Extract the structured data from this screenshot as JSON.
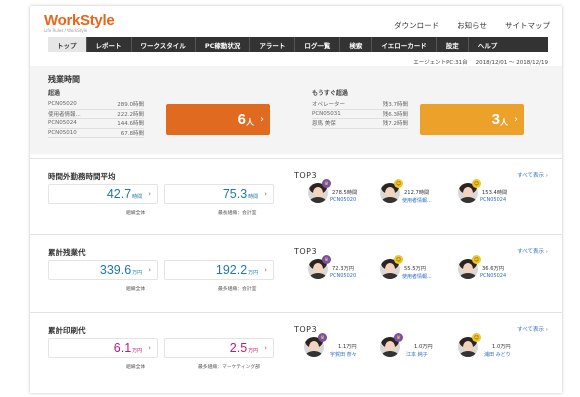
{
  "app": {
    "logo": "WorkStyle",
    "logo_sub": "Life Rules / WorkStyle"
  },
  "topnav": [
    "ダウンロード",
    "お知らせ",
    "サイトマップ"
  ],
  "menu": [
    "トップ",
    "レポート",
    "ワークスタイル",
    "PC稼動状況",
    "アラート",
    "ログ一覧",
    "検索",
    "イエローカード",
    "設定",
    "ヘルプ"
  ],
  "subinfo": {
    "agent": "エージェントPC:31台",
    "period": "2018/12/01 ～ 2018/12/19"
  },
  "overtime": {
    "title": "残業時間",
    "exceeded": {
      "label": "超過",
      "rows": [
        {
          "name": "PCN05020",
          "value": "289.0時間"
        },
        {
          "name": "使用者情報...",
          "value": "222.2時間"
        },
        {
          "name": "PCN05024",
          "value": "144.6時間"
        },
        {
          "name": "PCN05010",
          "value": "67.8時間"
        }
      ],
      "count": "6",
      "unit": "人"
    },
    "soon": {
      "label": "もうすぐ超過",
      "rows": [
        {
          "name": "オペレーター",
          "value": "残3.7時間"
        },
        {
          "name": "PCN05031",
          "value": "残6.3時間"
        },
        {
          "name": "恩馬 美保",
          "value": "残7.2時間"
        }
      ],
      "count": "3",
      "unit": "人"
    },
    "colors": {
      "exceeded": "#e06a1f",
      "soon": "#eba12a"
    }
  },
  "sections": [
    {
      "title": "時間外勤務時間平均",
      "card1": {
        "value": "42.7",
        "unit": "時間",
        "caption": "組織全体",
        "color": "#1e77a8"
      },
      "card2": {
        "value": "75.3",
        "unit": "時間",
        "caption": "最長組織：会計室",
        "color": "#1e77a8"
      },
      "top3_label": "TOP3",
      "show_all": "すべて表示 ›",
      "people": [
        {
          "value": "278.5時間",
          "name": "PCN05020",
          "badge": "purple-crown-icon"
        },
        {
          "value": "212.7時間",
          "name": "使用者情報...",
          "badge": "yellow-face-icon"
        },
        {
          "value": "153.4時間",
          "name": "PCN05024",
          "badge": "yellow-face-icon"
        }
      ]
    },
    {
      "title": "累計残業代",
      "card1": {
        "value": "339.6",
        "unit": "万円",
        "caption": "組織全体",
        "color": "#1e77a8"
      },
      "card2": {
        "value": "192.2",
        "unit": "万円",
        "caption": "最多組織：会計室",
        "color": "#1e77a8"
      },
      "top3_label": "TOP3",
      "show_all": "すべて表示 ›",
      "people": [
        {
          "value": "72.3万円",
          "name": "PCN05020",
          "badge": "purple-crown-icon"
        },
        {
          "value": "55.5万円",
          "name": "使用者情報...",
          "badge": "yellow-face-icon"
        },
        {
          "value": "36.6万円",
          "name": "PCN05024",
          "badge": "yellow-face-icon"
        }
      ]
    },
    {
      "title": "累計印刷代",
      "card1": {
        "value": "6.1",
        "unit": "万円",
        "caption": "組織全体",
        "color": "#c2187a"
      },
      "card2": {
        "value": "2.5",
        "unit": "万円",
        "caption": "最多組織：マーケティング部",
        "color": "#c2187a"
      },
      "top3_label": "TOP3",
      "show_all": "すべて表示 ›",
      "people": [
        {
          "value": "1.1万円",
          "name": "宇賀田 奈々",
          "badge": "purple-crown-icon"
        },
        {
          "value": "1.0万円",
          "name": "江本 純子",
          "badge": "purple-crown-icon"
        },
        {
          "value": "1.0万円",
          "name": "浦田 みどり",
          "badge": "yellow-face-icon"
        }
      ]
    }
  ]
}
